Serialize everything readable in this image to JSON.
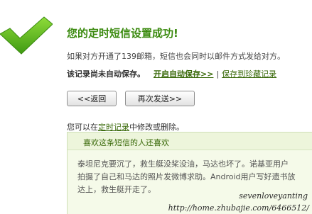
{
  "colors": {
    "title_green": "#3a8a0e",
    "link_green": "#3a6a0a",
    "panel_bg": "#f5fae9",
    "check_green": "#6cc22a"
  },
  "icon": "checkmark-icon",
  "title": "您的定时短信设置成功!",
  "info": "如果对方开通了139邮箱，短信也会同时以邮件方式发给对方。",
  "record": {
    "note": "该记录尚未自动保存。",
    "auto_save_link": "开启自动保存>>",
    "separator": "|",
    "collect_link": "保存到珍藏记录"
  },
  "buttons": {
    "back": "<<返回",
    "resend": "再次发送>>"
  },
  "edit": {
    "prefix": "您可以在",
    "link": "定时记录",
    "suffix": "中修改或删除。"
  },
  "panel": {
    "title": "喜欢这条短信的人还喜欢",
    "lines": [
      "泰坦尼克要沉了，救生艇没桨没油，马达也坏了。诺基亚用户",
      "拍摄了自己和马达的照片发微博求助。Android用户写好遗书放",
      "达上，救生艇开走了。"
    ]
  },
  "watermark": {
    "author": "sevenloveyanting",
    "url": "http://home.zhubajie.com/6466512/"
  }
}
